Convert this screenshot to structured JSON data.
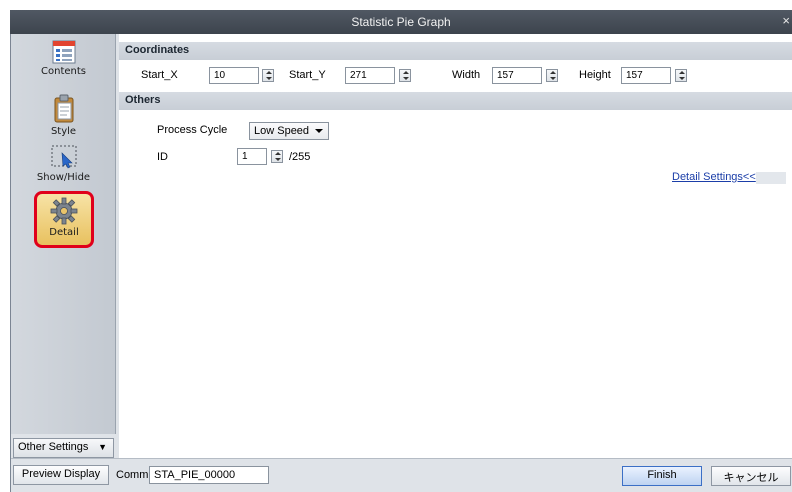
{
  "window": {
    "title": "Statistic Pie Graph",
    "close_glyph": "×"
  },
  "sidebar": {
    "items": [
      {
        "label": "Contents",
        "icon": "contents-icon"
      },
      {
        "label": "Style",
        "icon": "clipboard-icon"
      },
      {
        "label": "Show/Hide",
        "icon": "show-hide-icon"
      },
      {
        "label": "Detail",
        "icon": "gear-icon",
        "active": true
      }
    ],
    "other_settings": "Other Settings"
  },
  "coordinates": {
    "heading": "Coordinates",
    "start_x_label": "Start_X",
    "start_x": "10",
    "start_y_label": "Start_Y",
    "start_y": "271",
    "width_label": "Width",
    "width": "157",
    "height_label": "Height",
    "height": "157"
  },
  "others": {
    "heading": "Others",
    "process_cycle_label": "Process Cycle",
    "process_cycle_value": "Low Speed",
    "id_label": "ID",
    "id_value": "1",
    "id_max": "/255",
    "detail_link": "Detail Settings<<"
  },
  "footer": {
    "preview_button": "Preview Display",
    "comm_label": "Comm",
    "comm_value": "STA_PIE_00000",
    "finish_button": "Finish",
    "cancel_button": "キャンセル"
  },
  "colors": {
    "titlebar": "#48505a",
    "active_highlight": "#e0001b",
    "link": "#1b3ea8"
  }
}
